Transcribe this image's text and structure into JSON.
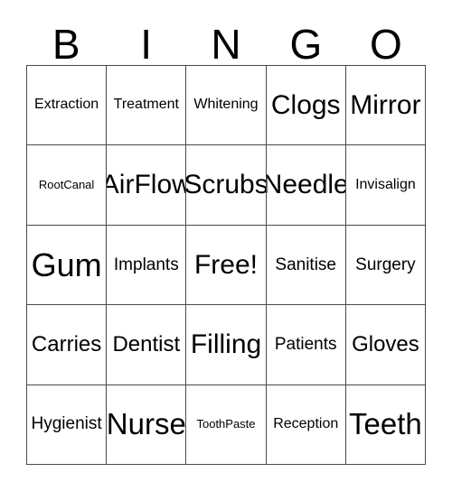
{
  "card": {
    "title": "BINGO",
    "header_letters": [
      "B",
      "I",
      "N",
      "G",
      "O"
    ],
    "free_space_label": "Free!",
    "colors": {
      "background": "#ffffff",
      "text": "#000000",
      "grid_line": "#4a4a4a"
    },
    "rows": [
      [
        {
          "label": "Extraction",
          "size": "s"
        },
        {
          "label": "Treatment",
          "size": "s"
        },
        {
          "label": "Whitening",
          "size": "s"
        },
        {
          "label": "Clogs",
          "size": "xl"
        },
        {
          "label": "Mirror",
          "size": "xl"
        }
      ],
      [
        {
          "label": "RootCanal",
          "size": "xs"
        },
        {
          "label": "AirFlow",
          "size": "xl"
        },
        {
          "label": "Scrubs",
          "size": "xl"
        },
        {
          "label": "Needle",
          "size": "xl"
        },
        {
          "label": "Invisalign",
          "size": "s"
        }
      ],
      [
        {
          "label": "Gum",
          "size": "xxxl"
        },
        {
          "label": "Implants",
          "size": "m"
        },
        {
          "label": "Free!",
          "size": "xl"
        },
        {
          "label": "Sanitise",
          "size": "m"
        },
        {
          "label": "Surgery",
          "size": "m"
        }
      ],
      [
        {
          "label": "Carries",
          "size": "l"
        },
        {
          "label": "Dentist",
          "size": "l"
        },
        {
          "label": "Filling",
          "size": "xl"
        },
        {
          "label": "Patients",
          "size": "m"
        },
        {
          "label": "Gloves",
          "size": "l"
        }
      ],
      [
        {
          "label": "Hygienist",
          "size": "m"
        },
        {
          "label": "Nurse",
          "size": "xxl"
        },
        {
          "label": "ToothPaste",
          "size": "xs"
        },
        {
          "label": "Reception",
          "size": "s"
        },
        {
          "label": "Teeth",
          "size": "xxl"
        }
      ]
    ]
  }
}
